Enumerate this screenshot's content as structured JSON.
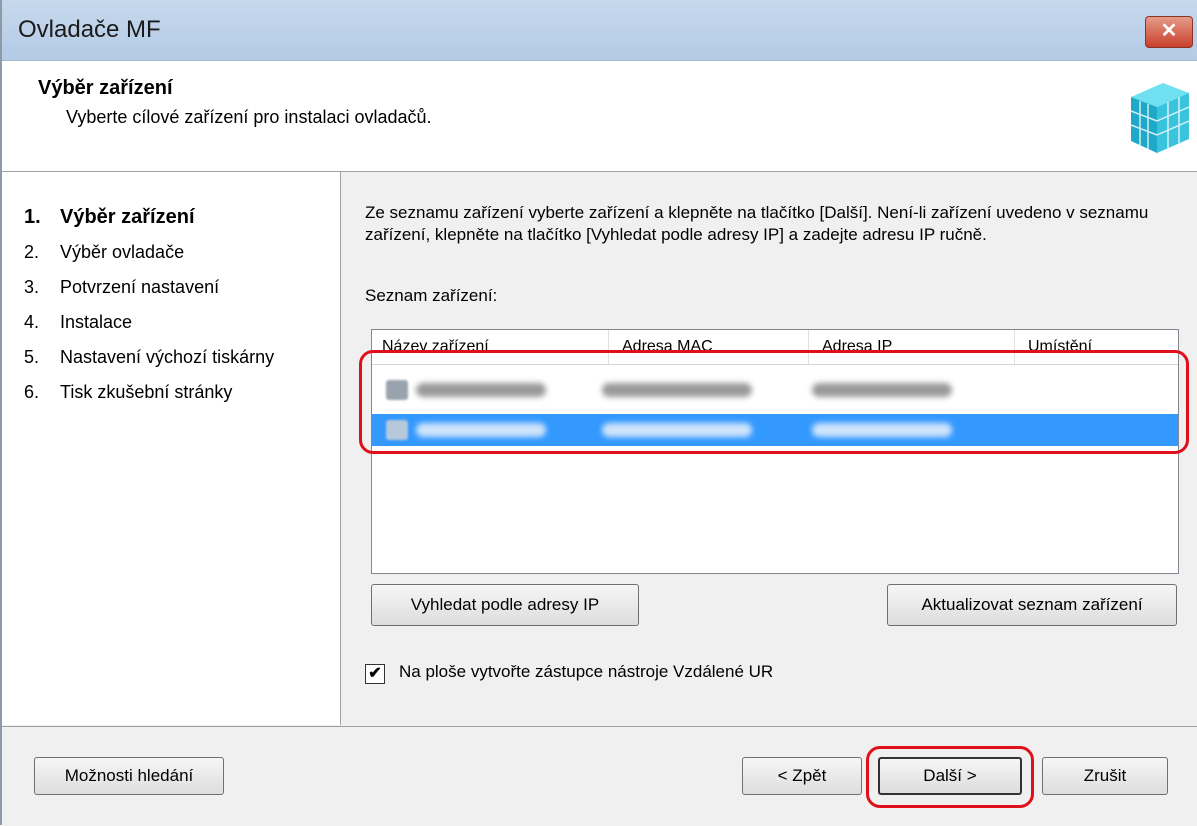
{
  "window": {
    "title": "Ovladače MF",
    "close_label": "✕"
  },
  "header": {
    "title": "Výběr zařízení",
    "subtitle": "Vyberte cílové zařízení pro instalaci ovladačů."
  },
  "steps": [
    {
      "num": "1.",
      "label": "Výběr zařízení",
      "active": true
    },
    {
      "num": "2.",
      "label": "Výběr ovladače"
    },
    {
      "num": "3.",
      "label": "Potvrzení nastavení"
    },
    {
      "num": "4.",
      "label": "Instalace"
    },
    {
      "num": "5.",
      "label": "Nastavení výchozí tiskárny"
    },
    {
      "num": "6.",
      "label": "Tisk zkušební stránky"
    }
  ],
  "main": {
    "description": "Ze seznamu zařízení vyberte zařízení a klepněte na tlačítko [Další]. Není-li zařízení uvedeno v seznamu zařízení, klepněte na tlačítko [Vyhledat podle adresy IP] a zadejte adresu IP ručně.",
    "list_label": "Seznam zařízení:",
    "columns": [
      "Název zařízení",
      "Adresa MAC",
      "Adresa IP",
      "Umístění"
    ],
    "search_ip_button": "Vyhledat podle adresy IP",
    "refresh_button": "Aktualizovat seznam zařízení",
    "shortcut_checkbox": {
      "label": "Na ploše vytvořte zástupce nástroje Vzdálené UR",
      "checked": true,
      "check_mark": "✔"
    }
  },
  "footer": {
    "options_button": "Možnosti hledání",
    "back_button": "< Zpět",
    "next_button": "Další >",
    "cancel_button": "Zrušit"
  },
  "colors": {
    "selection": "#3399ff",
    "highlight": "#e0101a",
    "accent": "#2aa6c8"
  }
}
